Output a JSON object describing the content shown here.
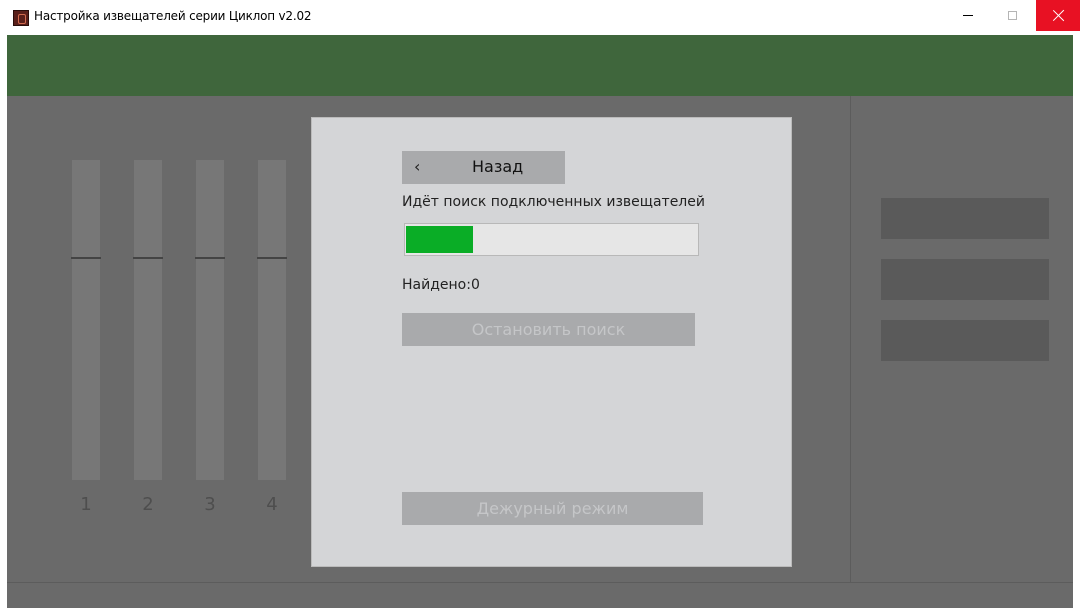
{
  "window": {
    "title": "Настройка извещателей серии Циклоп v2.02"
  },
  "channels": [
    {
      "label": "1"
    },
    {
      "label": "2"
    },
    {
      "label": "3"
    },
    {
      "label": "4"
    }
  ],
  "dialog": {
    "back_label": "Назад",
    "back_chevron": "‹",
    "status": "Идёт поиск подключенных извещателей",
    "progress_fraction": 0.23,
    "found_label": "Найдено:",
    "found_count": "0",
    "stop_button": "Остановить поиск",
    "duty_button": "Дежурный режим"
  },
  "colors": {
    "header_green": "#3f663c",
    "progress_green": "#0aad26",
    "close_red": "#e81123"
  },
  "icons": {
    "app": "cyclops-app-icon",
    "minimize": "minimize-icon",
    "maximize": "maximize-icon",
    "close": "close-icon"
  }
}
